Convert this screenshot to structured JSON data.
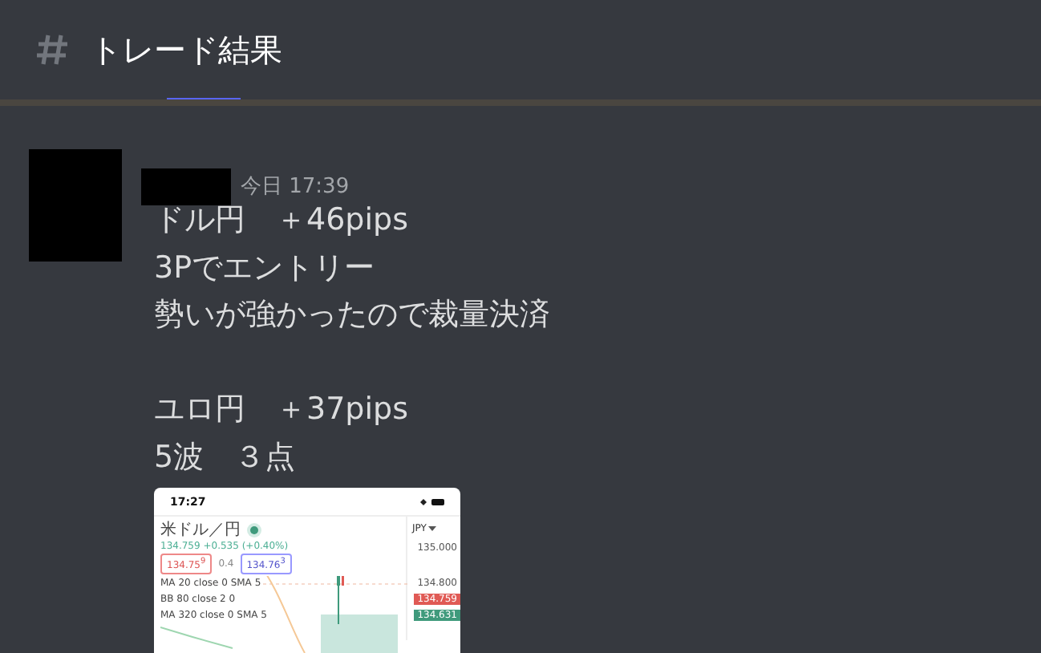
{
  "channel": {
    "title": "トレード結果"
  },
  "message": {
    "timestamp": "今日 17:39",
    "paragraphs": [
      [
        "ドル円　＋46pips",
        "3Pでエントリー",
        "勢いが強かったので裁量決済"
      ],
      [
        "ユロ円　＋37pips",
        "5波　３点"
      ]
    ],
    "attachment": {
      "status_time": "17:27",
      "pair": "米ドル／円",
      "quote": "134.759 +0.535 (+0.40%)",
      "bid": "134.75$^{9}$",
      "spread": "0.4",
      "ask": "134.76$^{3}$",
      "indicators": [
        "MA 20 close 0 SMA 5",
        "BB 80 close 2 0",
        "MA 320 close 0 SMA 5"
      ],
      "currency": "JPY",
      "axis_labels": [
        "135.000",
        "134.800"
      ],
      "price_tags": [
        {
          "text": "134.759",
          "color": "#e05a55"
        },
        {
          "text": "134.631",
          "color": "#3f9a7c"
        }
      ]
    }
  }
}
